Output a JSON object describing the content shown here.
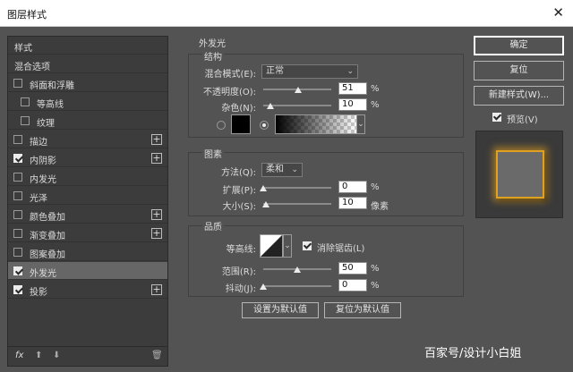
{
  "window": {
    "title": "图层样式",
    "close_glyph": "✕"
  },
  "sidebar": {
    "items": [
      {
        "label": "样式",
        "checkbox": null,
        "plus": false,
        "active": false
      },
      {
        "label": "混合选项",
        "checkbox": null,
        "plus": false,
        "active": false
      },
      {
        "label": "斜面和浮雕",
        "checkbox": false,
        "plus": false,
        "active": false
      },
      {
        "label": "等高线",
        "checkbox": false,
        "plus": false,
        "active": false,
        "sub": true
      },
      {
        "label": "纹理",
        "checkbox": false,
        "plus": false,
        "active": false,
        "sub": true
      },
      {
        "label": "描边",
        "checkbox": false,
        "plus": true,
        "active": false
      },
      {
        "label": "内阴影",
        "checkbox": true,
        "plus": true,
        "active": false
      },
      {
        "label": "内发光",
        "checkbox": false,
        "plus": false,
        "active": false
      },
      {
        "label": "光泽",
        "checkbox": false,
        "plus": false,
        "active": false
      },
      {
        "label": "颜色叠加",
        "checkbox": false,
        "plus": true,
        "active": false
      },
      {
        "label": "渐变叠加",
        "checkbox": false,
        "plus": true,
        "active": false
      },
      {
        "label": "图案叠加",
        "checkbox": false,
        "plus": false,
        "active": false
      },
      {
        "label": "外发光",
        "checkbox": true,
        "plus": false,
        "active": true
      },
      {
        "label": "投影",
        "checkbox": true,
        "plus": true,
        "active": false
      }
    ],
    "footer": {
      "fx": "fx",
      "up": "⬆",
      "down": "⬇",
      "trash": "🗑"
    }
  },
  "panel": {
    "title": "外发光",
    "structure": {
      "title": "结构",
      "blend_mode_label": "混合模式(E):",
      "blend_mode_value": "正常",
      "opacity_label": "不透明度(O):",
      "opacity_value": "51",
      "opacity_unit": "%",
      "opacity_fraction": 0.51,
      "noise_label": "杂色(N):",
      "noise_value": "10",
      "noise_unit": "%",
      "noise_fraction": 0.1
    },
    "elements": {
      "title": "图素",
      "technique_label": "方法(Q):",
      "technique_value": "柔和",
      "spread_label": "扩展(P):",
      "spread_value": "0",
      "spread_unit": "%",
      "spread_fraction": 0,
      "size_label": "大小(S):",
      "size_value": "10",
      "size_unit": "像素",
      "size_fraction": 0.04
    },
    "quality": {
      "title": "品质",
      "contour_label": "等高线:",
      "antialias_label": "消除锯齿(L)",
      "range_label": "范围(R):",
      "range_value": "50",
      "range_unit": "%",
      "range_fraction": 0.5,
      "jitter_label": "抖动(J):",
      "jitter_value": "0",
      "jitter_unit": "%",
      "jitter_fraction": 0
    },
    "buttons": {
      "make_default": "设置为默认值",
      "reset_default": "复位为默认值"
    }
  },
  "right": {
    "ok": "确定",
    "reset": "复位",
    "new_style": "新建样式(W)...",
    "preview_label": "预览(V)"
  },
  "colors": {
    "glow": "#e0a020",
    "solid": "#000000"
  },
  "watermark": "百家号/设计小白姐"
}
